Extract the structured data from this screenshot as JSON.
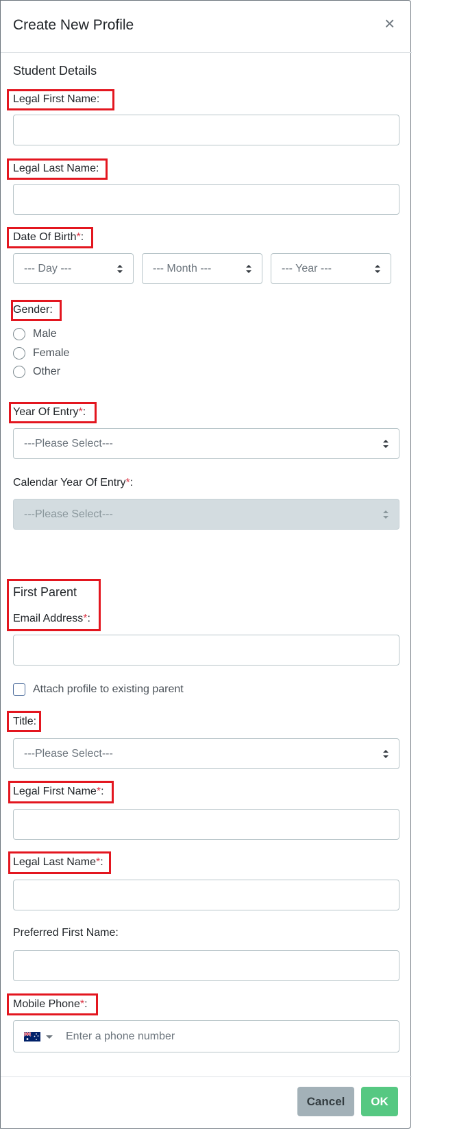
{
  "modal": {
    "title": "Create New Profile",
    "close_glyph": "×"
  },
  "student": {
    "section_title": "Student Details",
    "first_name_label": "Legal First Name:",
    "last_name_label": "Legal Last Name:",
    "dob_label": "Date Of Birth",
    "dob_day": "--- Day ---",
    "dob_month": "--- Month ---",
    "dob_year": "--- Year ---",
    "gender_label": "Gender:",
    "gender_options": [
      "Male",
      "Female",
      "Other"
    ],
    "year_of_entry_label": "Year Of Entry",
    "year_of_entry_value": "---Please Select---",
    "calendar_year_label": "Calendar Year Of Entry",
    "calendar_year_value": "---Please Select---"
  },
  "parent": {
    "section_title": "First Parent",
    "email_label": "Email Address",
    "attach_label": "Attach profile to existing parent",
    "title_label": "Title:",
    "title_value": "---Please Select---",
    "first_name_label": "Legal First Name",
    "last_name_label": "Legal Last Name",
    "preferred_name_label": "Preferred First Name:",
    "mobile_label": "Mobile Phone",
    "phone_placeholder": "Enter a phone number",
    "flag_icon": "australia-flag-icon"
  },
  "common": {
    "required_mark": "*",
    "colon": ":"
  },
  "footer": {
    "cancel_label": "Cancel",
    "ok_label": "OK"
  },
  "colors": {
    "highlight": "#e3161f",
    "required": "#dc3545",
    "ok_button": "#56c882",
    "cancel_button": "#a3b1b8"
  }
}
